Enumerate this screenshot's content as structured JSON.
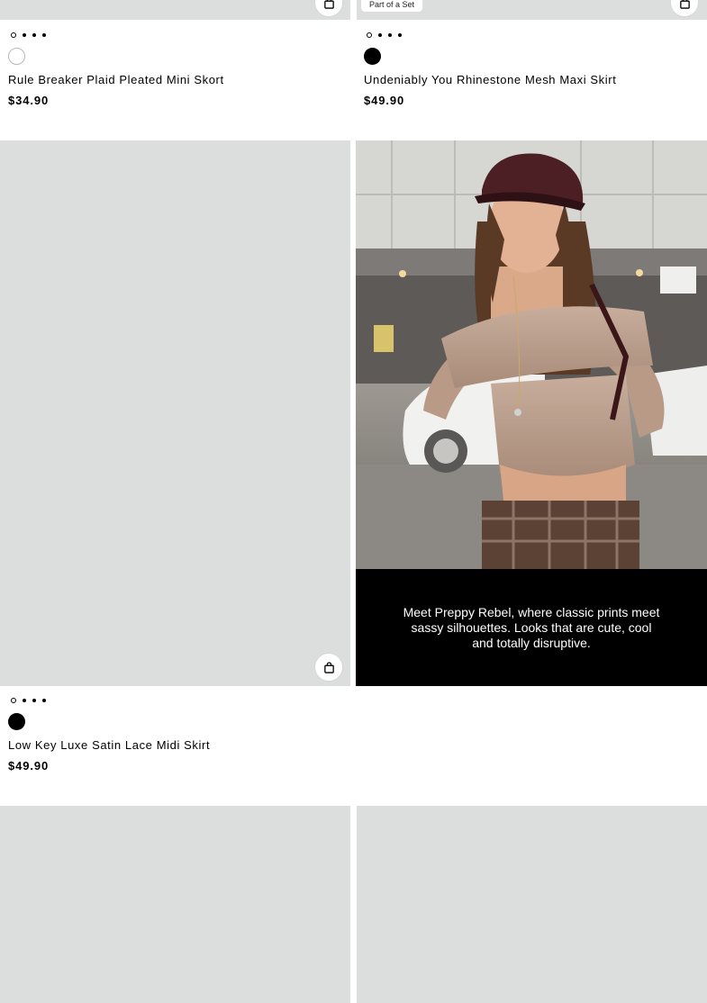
{
  "products": [
    {
      "name": "Rule Breaker Plaid Pleated Mini Skort",
      "price": "$34.90",
      "swatch": "white",
      "badge": ""
    },
    {
      "name": "Undeniably You Rhinestone Mesh Maxi Skirt",
      "price": "$49.90",
      "swatch": "black",
      "badge": "Part of a Set"
    },
    {
      "name": "Low Key Luxe Satin Lace Midi Skirt",
      "price": "$49.90",
      "swatch": "black",
      "badge": ""
    }
  ],
  "editorial": {
    "text": "Meet Preppy Rebel, where classic prints meet sassy silhouettes. Looks that are cute, cool and totally disruptive."
  },
  "icons": {
    "cart": "shopping-bag-icon"
  },
  "colors": {
    "placeholder": "#dcdedd",
    "promo_bg": "#000000",
    "text": "#000000"
  }
}
